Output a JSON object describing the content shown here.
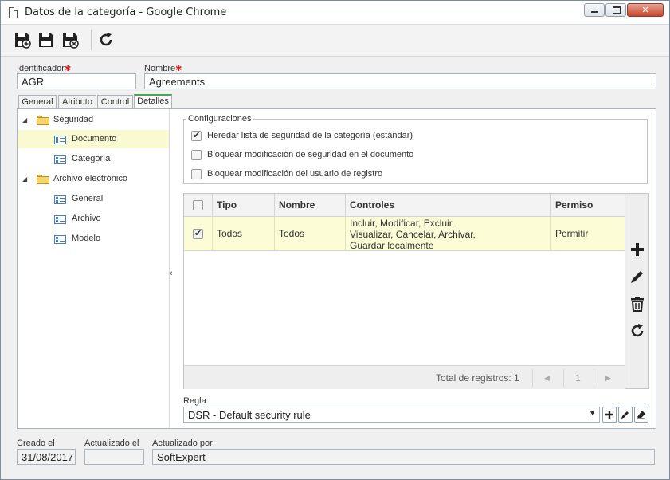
{
  "window": {
    "title": "Datos de la categoría - Google Chrome"
  },
  "toolbar": {
    "buttons": [
      {
        "name": "save-new-icon"
      },
      {
        "name": "save-icon"
      },
      {
        "name": "save-close-icon"
      },
      {
        "name": "refresh-icon"
      }
    ]
  },
  "form": {
    "id_label": "Identificador",
    "id_value": "AGR",
    "name_label": "Nombre",
    "name_value": "Agreements",
    "required_mark": "✱"
  },
  "tabs": [
    "General",
    "Atributo",
    "Control",
    "Detalles"
  ],
  "active_tab": "Detalles",
  "tree": {
    "items": [
      {
        "label": "Seguridad",
        "level": 0,
        "type": "folder",
        "expanded": true
      },
      {
        "label": "Documento",
        "level": 1,
        "type": "record",
        "selected": true
      },
      {
        "label": "Categoría",
        "level": 1,
        "type": "record"
      },
      {
        "label": "Archivo electrónico",
        "level": 0,
        "type": "folder",
        "expanded": true
      },
      {
        "label": "General",
        "level": 1,
        "type": "record"
      },
      {
        "label": "Archivo",
        "level": 1,
        "type": "record"
      },
      {
        "label": "Modelo",
        "level": 1,
        "type": "record"
      }
    ]
  },
  "config": {
    "legend": "Configuraciones",
    "options": [
      {
        "label": "Heredar lista de seguridad de la categoría (estándar)",
        "checked": true
      },
      {
        "label": "Bloquear modificación de seguridad en el documento",
        "checked": false
      },
      {
        "label": "Bloquear modificación del usuario de registro",
        "checked": false
      }
    ]
  },
  "grid": {
    "columns": [
      "Tipo",
      "Nombre",
      "Controles",
      "Permiso"
    ],
    "rows": [
      {
        "checked": true,
        "tipo": "Todos",
        "nombre": "Todos",
        "controles": [
          "Incluir, Modificar, Excluir,",
          "Visualizar, Cancelar, Archivar,",
          "Guardar localmente"
        ],
        "permiso": "Permitir"
      }
    ],
    "total_label": "Total de registros: 1",
    "page": "1",
    "side_buttons": [
      "add-icon",
      "edit-icon",
      "delete-icon",
      "refresh-icon"
    ]
  },
  "regla": {
    "label": "Regla",
    "value": "DSR - Default security rule"
  },
  "footer": {
    "created_label": "Creado el",
    "created_value": "31/08/2017",
    "updated_label": "Actualizado el",
    "updated_value": "",
    "updated_by_label": "Actualizado por",
    "updated_by_value": "SoftExpert"
  },
  "colors": {
    "selected_row": "#fcfcd6",
    "active_tab_accent": "#4aa84a",
    "close_button": "#c9462c"
  }
}
